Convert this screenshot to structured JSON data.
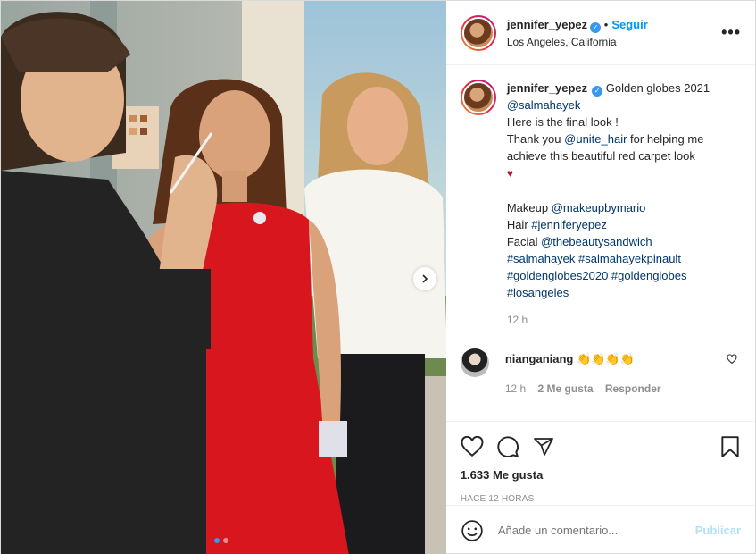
{
  "post": {
    "username": "jennifer_yepez",
    "follow_label": "Seguir",
    "location": "Los Angeles, California",
    "more_label": "•••"
  },
  "caption": {
    "username": "jennifer_yepez",
    "title": "Golden globes 2021",
    "mention": "@salmahayek",
    "line1": "Here is the final look !",
    "line2_pre": "Thank you ",
    "line2_mention": "@unite_hair",
    "line2_post": " for helping me",
    "line3": "achieve this beautiful red carpet look",
    "heart": "♥",
    "makeup_label": "Makeup ",
    "makeup_mention": "@makeupbymario",
    "hair_label": "Hair ",
    "hair_tag": "#jenniferyepez",
    "facial_label": "Facial ",
    "facial_mention": "@thebeautysandwich",
    "tags1": "#salmahayek #salmahayekpinault",
    "tags2": "#goldenglobes2020 #goldenglobes",
    "tags3": "#losangeles",
    "time": "12 h"
  },
  "comment": {
    "username": "nianganiang",
    "text": "👏👏👏👏",
    "time": "12 h",
    "likes": "2 Me gusta",
    "reply": "Responder"
  },
  "actions": {
    "likes": "1.633 Me gusta",
    "ago": "HACE 12 HORAS"
  },
  "add_comment": {
    "placeholder": "Añade un comentario...",
    "publish": "Publicar"
  },
  "carousel": {
    "count": 2,
    "active_index": 0
  },
  "colors": {
    "accent": "#0095f6",
    "verified": "#3897f0",
    "link": "#00376b",
    "heart": "#c0142a",
    "dress": "#d8161e"
  }
}
